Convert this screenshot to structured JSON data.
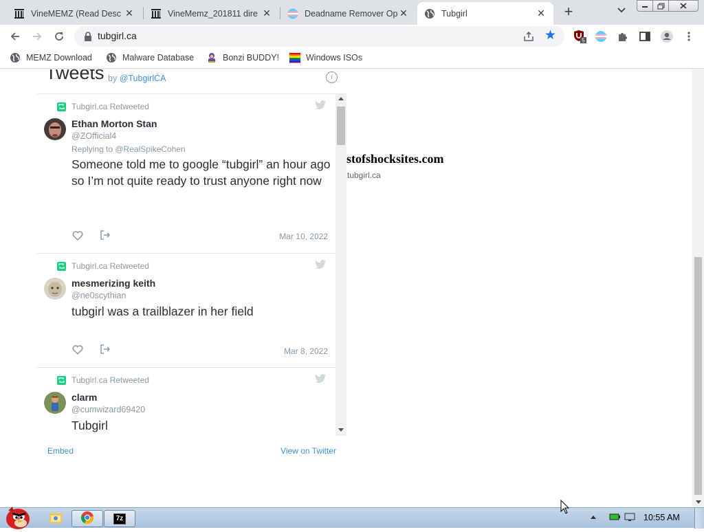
{
  "browser": {
    "tabs": [
      {
        "label": "VineMEMZ (Read Desc",
        "active": false
      },
      {
        "label": "VineMemz_201811 dire",
        "active": false
      },
      {
        "label": "Deadname Remover Op",
        "active": false
      },
      {
        "label": "Tubgirl",
        "active": true
      }
    ],
    "new_tab_label": "+",
    "url": "tubgirl.ca",
    "extension_badge": "5",
    "accent_color": "#1a73e8",
    "bookmarks": [
      {
        "label": "MEMZ Download",
        "icon": "globe-icon"
      },
      {
        "label": "Malware Database",
        "icon": "globe-icon"
      },
      {
        "label": "Bonzi BUDDY!",
        "icon": "bonzi-icon"
      },
      {
        "label": "Windows ISOs",
        "icon": "windows-flag-icon"
      }
    ]
  },
  "page": {
    "background_title": "stofshocksites.com",
    "background_subtitle": "tubgirl.ca",
    "widget": {
      "title": "Tweets",
      "by_prefix": "by ",
      "by_handle": "@TubgirlCA",
      "info_icon": "i",
      "tweets": [
        {
          "retweeted_by": "Tubgirl.ca Retweeted",
          "name": "Ethan Morton Stan",
          "handle": "@ZOfficial4",
          "reply_to": "Replying to @RealSpikeCohen",
          "text": "Someone told me to google “tubgirl” an hour ago so I’m not quite ready to trust anyone right now",
          "date": "Mar 10, 2022"
        },
        {
          "retweeted_by": "Tubgirl.ca Retweeted",
          "name": "mesmerizing keith",
          "handle": "@ne0scythian",
          "text": "tubgirl was a trailblazer in her field",
          "date": "Mar 8, 2022"
        },
        {
          "retweeted_by": "Tubgirl.ca Retweeted",
          "name": "clarm",
          "handle": "@cumwizard69420",
          "text": "Tubgirl"
        }
      ],
      "embed_label": "Embed",
      "view_label": "View on Twitter",
      "retweet_color": "#19cf86",
      "link_color": "#3b94d9"
    }
  },
  "taskbar": {
    "clock": "10:55 AM",
    "items": [
      "explorer-icon",
      "chrome-icon",
      "7zip-icon"
    ],
    "item_7z_label": "7z"
  }
}
